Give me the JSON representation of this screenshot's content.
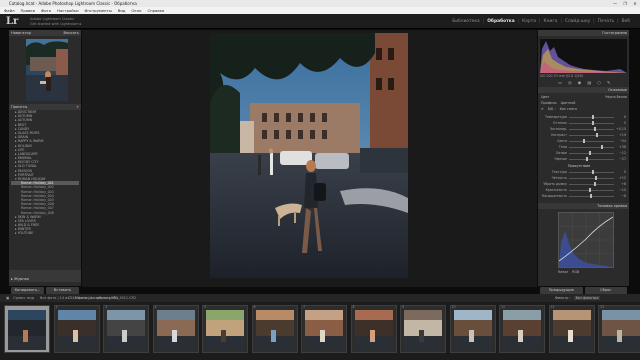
{
  "window": {
    "title": "Catalog.lrcat - Adobe Photoshop Lightroom Classic - Обработка",
    "controls": [
      "—",
      "❐",
      "✕"
    ]
  },
  "menu": [
    "Файл",
    "Правка",
    "Фото",
    "Настройки",
    "Инструменты",
    "Вид",
    "Окно",
    "Справка"
  ],
  "header": {
    "logo": "Lr",
    "catalog_line1": "Adobe Lightroom Classic",
    "catalog_line2": "Get started with Lightroom ▸",
    "modules": [
      "Библиотека",
      "Обработка",
      "Карта",
      "Книга",
      "Слайд-шоу",
      "Печать",
      "Веб"
    ],
    "active_module": "Обработка"
  },
  "left_panel": {
    "navigator_title": "Навигатор",
    "navigator_zoom": "Вписать",
    "presets_title": "Пресеты",
    "presets": [
      {
        "label": "▸ ДЕЙСТВИЯ",
        "level": 0
      },
      {
        "label": "▸ AUTUMN",
        "level": 0
      },
      {
        "label": "▸ AUTUMN",
        "level": 0
      },
      {
        "label": "▸ BEST",
        "level": 0
      },
      {
        "label": "▸ CANDY",
        "level": 0
      },
      {
        "label": "▸ GLASS MORS",
        "level": 0
      },
      {
        "label": "▸ GRAIN",
        "level": 0
      },
      {
        "label": "▸ HAPPY & WARM",
        "level": 0
      },
      {
        "label": "▸ HOLIDAY",
        "level": 0
      },
      {
        "label": "▸ LIFE",
        "level": 0
      },
      {
        "label": "▸ LANDSCAPE",
        "level": 0
      },
      {
        "label": "▸ MINIMAL",
        "level": 0
      },
      {
        "label": "▸ MOODY CITY",
        "level": 0
      },
      {
        "label": "▸ OLD TONAL",
        "level": 0
      },
      {
        "label": "▸ PASSION",
        "level": 0
      },
      {
        "label": "▸ PORTRAIT",
        "level": 0
      },
      {
        "label": "▾ ROMAN HOLIDAY",
        "level": 0
      },
      {
        "label": "Roman Holiday_001",
        "level": 1,
        "selected": true
      },
      {
        "label": "Roman Holiday_002",
        "level": 1
      },
      {
        "label": "Roman Holiday_003",
        "level": 1
      },
      {
        "label": "Roman Holiday_004",
        "level": 1
      },
      {
        "label": "Roman Holiday_005",
        "level": 1
      },
      {
        "label": "Roman Holiday_006",
        "level": 1
      },
      {
        "label": "Roman Holiday_007",
        "level": 1
      },
      {
        "label": "Roman Holiday_008",
        "level": 1
      },
      {
        "label": "▸ SKIN & WARM",
        "level": 0
      },
      {
        "label": "▸ SPA LOVER",
        "level": 0
      },
      {
        "label": "▸ WILD & FREE",
        "level": 0
      },
      {
        "label": "▸ WINTER",
        "level": 0
      },
      {
        "label": "▸ YOUTUBE",
        "level": 0
      }
    ],
    "section_snapshots": "▸ Снимки",
    "section_history": "▸ Журнал",
    "section_presets_user": "▸ Пресеты пользователя",
    "copy_button": "Копировать...",
    "paste_button": "Вставить"
  },
  "right_panel": {
    "histogram_title": "Гистограмма",
    "histogram_info": "ISO 200  23 mm  f/2.8  1/250",
    "basic_title": "Основные",
    "profile_label": "Профиль",
    "profile_value": "Цветной",
    "treatment_color": "Цвет",
    "treatment_bw": "Чёрно-белое",
    "wb_label": "Б/Б :",
    "wb_value": "Как снято",
    "sliders": [
      {
        "label": "Температура",
        "value": "0",
        "pos": 0.5
      },
      {
        "label": "Оттенок",
        "value": "0",
        "pos": 0.52
      },
      {
        "label": "Экспонир.",
        "value": "+0,15",
        "pos": 0.55
      },
      {
        "label": "Контраст",
        "value": "+19",
        "pos": 0.6
      },
      {
        "label": "Света",
        "value": "−54",
        "pos": 0.3
      },
      {
        "label": "Тени",
        "value": "+38",
        "pos": 0.7
      },
      {
        "label": "Белые",
        "value": "−12",
        "pos": 0.45
      },
      {
        "label": "Чёрные",
        "value": "−27",
        "pos": 0.38
      }
    ],
    "presence_label": "Присутствие",
    "presence_sliders": [
      {
        "label": "Текстура",
        "value": "0",
        "pos": 0.5
      },
      {
        "label": "Чёткость",
        "value": "+12",
        "pos": 0.58
      },
      {
        "label": "Убрать дымку",
        "value": "+8",
        "pos": 0.55
      },
      {
        "label": "Красочность",
        "value": "−10",
        "pos": 0.44
      },
      {
        "label": "Насыщенность",
        "value": "−6",
        "pos": 0.47
      }
    ],
    "tone_curve_title": "Тоновая кривая",
    "channel_label": "Канал",
    "channel_value": "RGB",
    "prev_button": "Предыдущие",
    "reset_button": "Сброс"
  },
  "toolbar": {
    "view_label": "Сравн. вид",
    "soft_proof": "Имитация цветопробы"
  },
  "filmstrip": {
    "nav_info": "Все фото  |  14 из 148 фото  |  1 отобран  |  IMG_5011.CR2",
    "filter_label": "Фильтр :",
    "filter_value": "Без фильтра",
    "frames": [
      {
        "num": "1",
        "selected": true
      },
      {
        "num": "2"
      },
      {
        "num": "3"
      },
      {
        "num": "4"
      },
      {
        "num": "5"
      },
      {
        "num": "6"
      },
      {
        "num": "7"
      },
      {
        "num": "8"
      },
      {
        "num": "9"
      },
      {
        "num": "10"
      },
      {
        "num": "11"
      },
      {
        "num": "12"
      },
      {
        "num": "13"
      }
    ]
  }
}
